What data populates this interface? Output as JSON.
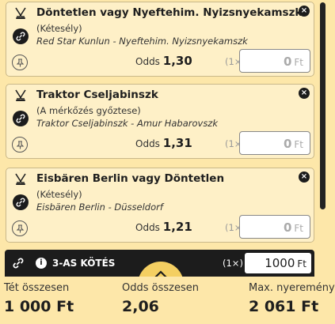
{
  "bets": [
    {
      "title": "Döntetlen vagy Nyeftehim. Nyizsnyekamszk",
      "subtitle": "(Kétesély)",
      "match": "Red Star Kunlun - Nyeftehim. Nyizsnyekamszk",
      "odds_label": "Odds",
      "odds": "1,30",
      "multiplier": "(1×)",
      "stake": "0",
      "currency": "Ft"
    },
    {
      "title": "Traktor Cseljabinszk",
      "subtitle": "(A mérkőzés győztese)",
      "match": "Traktor Cseljabinszk - Amur Habarovszk",
      "odds_label": "Odds",
      "odds": "1,31",
      "multiplier": "(1×)",
      "stake": "0",
      "currency": "Ft"
    },
    {
      "title": "Eisbären Berlin vagy Döntetlen",
      "subtitle": "(Kétesély)",
      "match": "Eisbären Berlin - Düsseldorf",
      "odds_label": "Odds",
      "odds": "1,21",
      "multiplier": "(1×)",
      "stake": "0",
      "currency": "Ft"
    }
  ],
  "system": {
    "label": "3-AS KÖTÉS",
    "multiplier": "(1×)",
    "stake": "1000",
    "currency": "Ft"
  },
  "summary": {
    "total_stake_label": "Tét összesen",
    "total_stake": "1 000 Ft",
    "total_odds_label": "Odds összesen",
    "total_odds": "2,06",
    "max_win_label": "Max. nyeremény",
    "max_win": "2 061 Ft"
  },
  "icons": {
    "sport": "hockey-sticks-icon",
    "link": "link-icon",
    "pin": "pin-icon",
    "close": "close-icon",
    "info": "info-icon",
    "collapse": "chevron-up-icon"
  },
  "colors": {
    "background": "#fde7a9",
    "card": "#fef0c7",
    "dark": "#1c1c1c",
    "accent": "#f4cf62"
  }
}
